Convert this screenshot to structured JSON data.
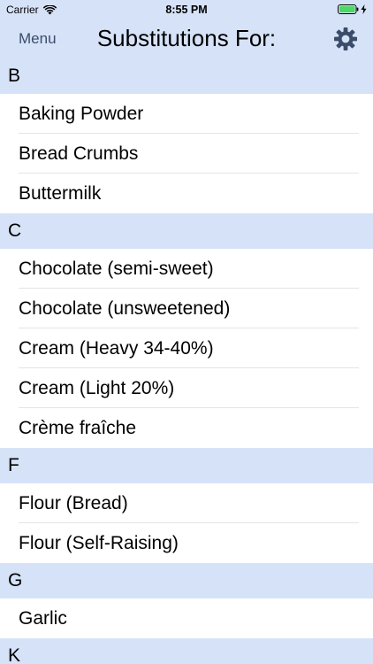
{
  "status_bar": {
    "carrier": "Carrier",
    "time": "8:55 PM"
  },
  "nav": {
    "menu_label": "Menu",
    "title": "Substitutions For:",
    "settings_icon": "gear-icon"
  },
  "colors": {
    "bar_background": "#d6e2f7",
    "menu_text": "#3b4c6b",
    "battery_fill": "#4cd964"
  },
  "sections": [
    {
      "letter": "B",
      "items": [
        "Baking Powder",
        "Bread Crumbs",
        "Buttermilk"
      ]
    },
    {
      "letter": "C",
      "items": [
        "Chocolate (semi-sweet)",
        "Chocolate (unsweetened)",
        "Cream (Heavy 34-40%)",
        "Cream (Light 20%)",
        "Crème fraîche"
      ]
    },
    {
      "letter": "F",
      "items": [
        "Flour (Bread)",
        "Flour (Self-Raising)"
      ]
    },
    {
      "letter": "G",
      "items": [
        "Garlic"
      ]
    },
    {
      "letter": "K",
      "items": []
    }
  ]
}
